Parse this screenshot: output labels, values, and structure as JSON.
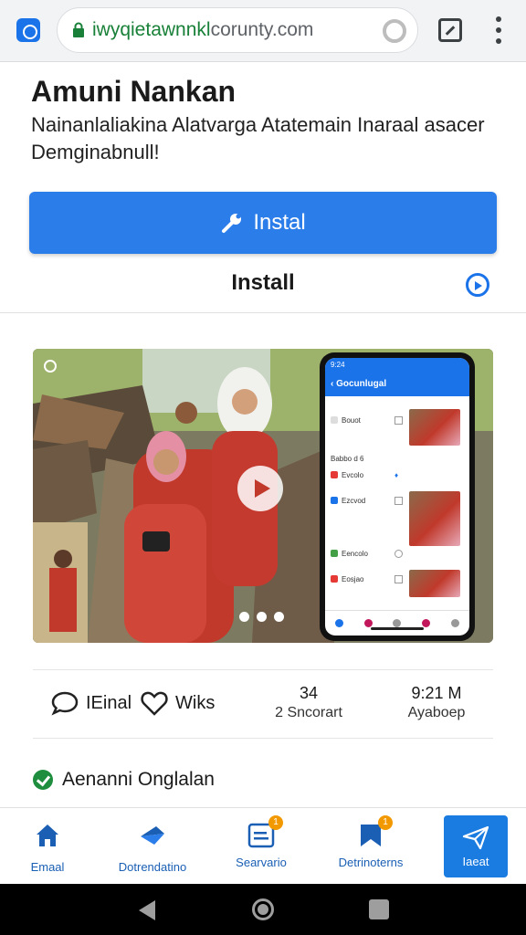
{
  "browser": {
    "url_host": "iwyqietawnnkl",
    "url_rest": "corunty.com",
    "icons": [
      "tab-icon",
      "lock-icon",
      "reload-icon",
      "tabs-icon",
      "menu-icon"
    ]
  },
  "app": {
    "title": "Amuni Nankan",
    "description": "Nainanlaliakina Alatvarga Atatemain Inaraal asacer Demginabnull!",
    "install_button": "Instal",
    "install_link": "Install"
  },
  "media": {
    "phone_title": "Gocunlugal",
    "phone_status_time": "9:24",
    "phone_rows": [
      "Bouot",
      "Babbo d 6",
      "Evcolo",
      "Ezcvod",
      "Eencolo",
      "Eosjao"
    ],
    "carousel_dots": 3
  },
  "stats": {
    "comment_label": "IEinal",
    "like_label": "Wiks",
    "downloads_value": "34",
    "downloads_sub": "2 Sncorart",
    "size_value": "9:21 M",
    "size_sub": "Ayaboep"
  },
  "verified": {
    "label": "Aenanni Onglalan"
  },
  "bottom_nav": {
    "items": [
      {
        "label": "Emaal",
        "icon": "home-icon"
      },
      {
        "label": "Dotrendatino",
        "icon": "plane-icon"
      },
      {
        "label": "Searvario",
        "icon": "card-icon",
        "badge": "1"
      },
      {
        "label": "Detrinoterns",
        "icon": "bookmark-icon",
        "badge": "1"
      }
    ],
    "cta_label": "Iaeat"
  },
  "colors": {
    "accent": "#2b7de9",
    "url_green": "#188038",
    "badge": "#f29900",
    "verified": "#1e8e3e"
  }
}
